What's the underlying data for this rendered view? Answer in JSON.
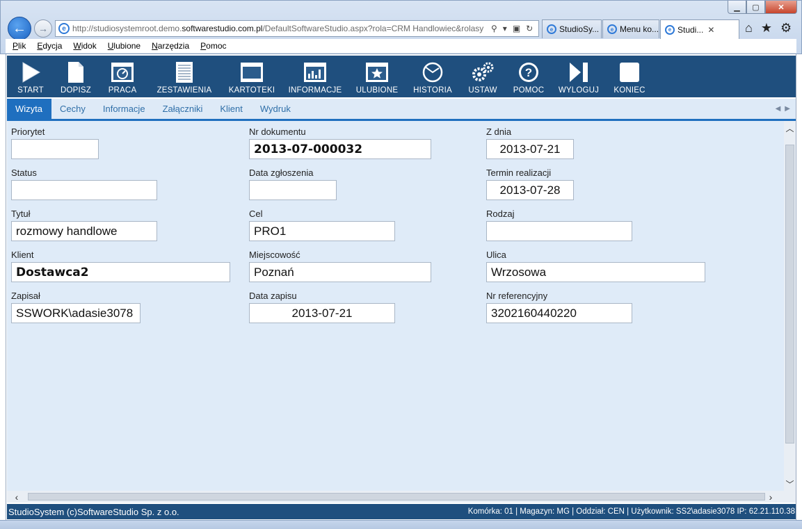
{
  "browser": {
    "url_prefix": "http://studiosystemroot.demo.",
    "url_domain": "softwarestudio.com.pl",
    "url_suffix": "/DefaultSoftwareStudio.aspx?rola=CRM Handlowiec&rolasy",
    "tabs": [
      {
        "label": "StudioSy..."
      },
      {
        "label": "Menu ko..."
      },
      {
        "label": "Studi..."
      }
    ],
    "close_tab": "✕"
  },
  "menubar": [
    "Plik",
    "Edycja",
    "Widok",
    "Ulubione",
    "Narzędzia",
    "Pomoc"
  ],
  "toolbar": [
    {
      "label": "START",
      "icon": "play-icon"
    },
    {
      "label": "DOPISZ",
      "icon": "document-icon"
    },
    {
      "label": "PRACA",
      "icon": "window-gauge-icon"
    },
    {
      "label": "ZESTAWIENIA",
      "icon": "report-icon"
    },
    {
      "label": "KARTOTEKI",
      "icon": "window-icon"
    },
    {
      "label": "INFORMACJE",
      "icon": "chart-icon"
    },
    {
      "label": "ULUBIONE",
      "icon": "star-icon"
    },
    {
      "label": "HISTORIA",
      "icon": "history-icon"
    },
    {
      "label": "USTAW",
      "icon": "gears-icon"
    },
    {
      "label": "POMOC",
      "icon": "help-icon"
    },
    {
      "label": "WYLOGUJ",
      "icon": "logout-icon"
    },
    {
      "label": "KONIEC",
      "icon": "stop-icon"
    }
  ],
  "tabs": [
    "Wizyta",
    "Cechy",
    "Informacje",
    "Załączniki",
    "Klient",
    "Wydruk"
  ],
  "form": {
    "priorytet": {
      "label": "Priorytet",
      "value": ""
    },
    "nr_dokumentu": {
      "label": "Nr dokumentu",
      "value": "2013-07-000032"
    },
    "z_dnia": {
      "label": "Z dnia",
      "value": "2013-07-21"
    },
    "status": {
      "label": "Status",
      "value": ""
    },
    "data_zgloszenia": {
      "label": "Data zgłoszenia",
      "value": ""
    },
    "termin_realizacji": {
      "label": "Termin realizacji",
      "value": "2013-07-28"
    },
    "tytul": {
      "label": "Tytuł",
      "value": "rozmowy handlowe"
    },
    "cel": {
      "label": "Cel",
      "value": "PRO1"
    },
    "rodzaj": {
      "label": "Rodzaj",
      "value": ""
    },
    "klient": {
      "label": "Klient",
      "value": "Dostawca2"
    },
    "miejscowosc": {
      "label": "Miejscowość",
      "value": "Poznań"
    },
    "ulica": {
      "label": "Ulica",
      "value": "Wrzosowa"
    },
    "zapisal": {
      "label": "Zapisał",
      "value": "SSWORK\\adasie3078"
    },
    "data_zapisu": {
      "label": "Data zapisu",
      "value": "2013-07-21"
    },
    "nr_referencyjny": {
      "label": "Nr referencyjny",
      "value": "3202160440220"
    }
  },
  "status": {
    "left": "StudioSystem (c)SoftwareStudio Sp. z o.o.",
    "right": "Komórka: 01 | Magazyn: MG | Oddział: CEN | Użytkownik: SS2\\adasie3078 IP: 62.21.110.38"
  }
}
